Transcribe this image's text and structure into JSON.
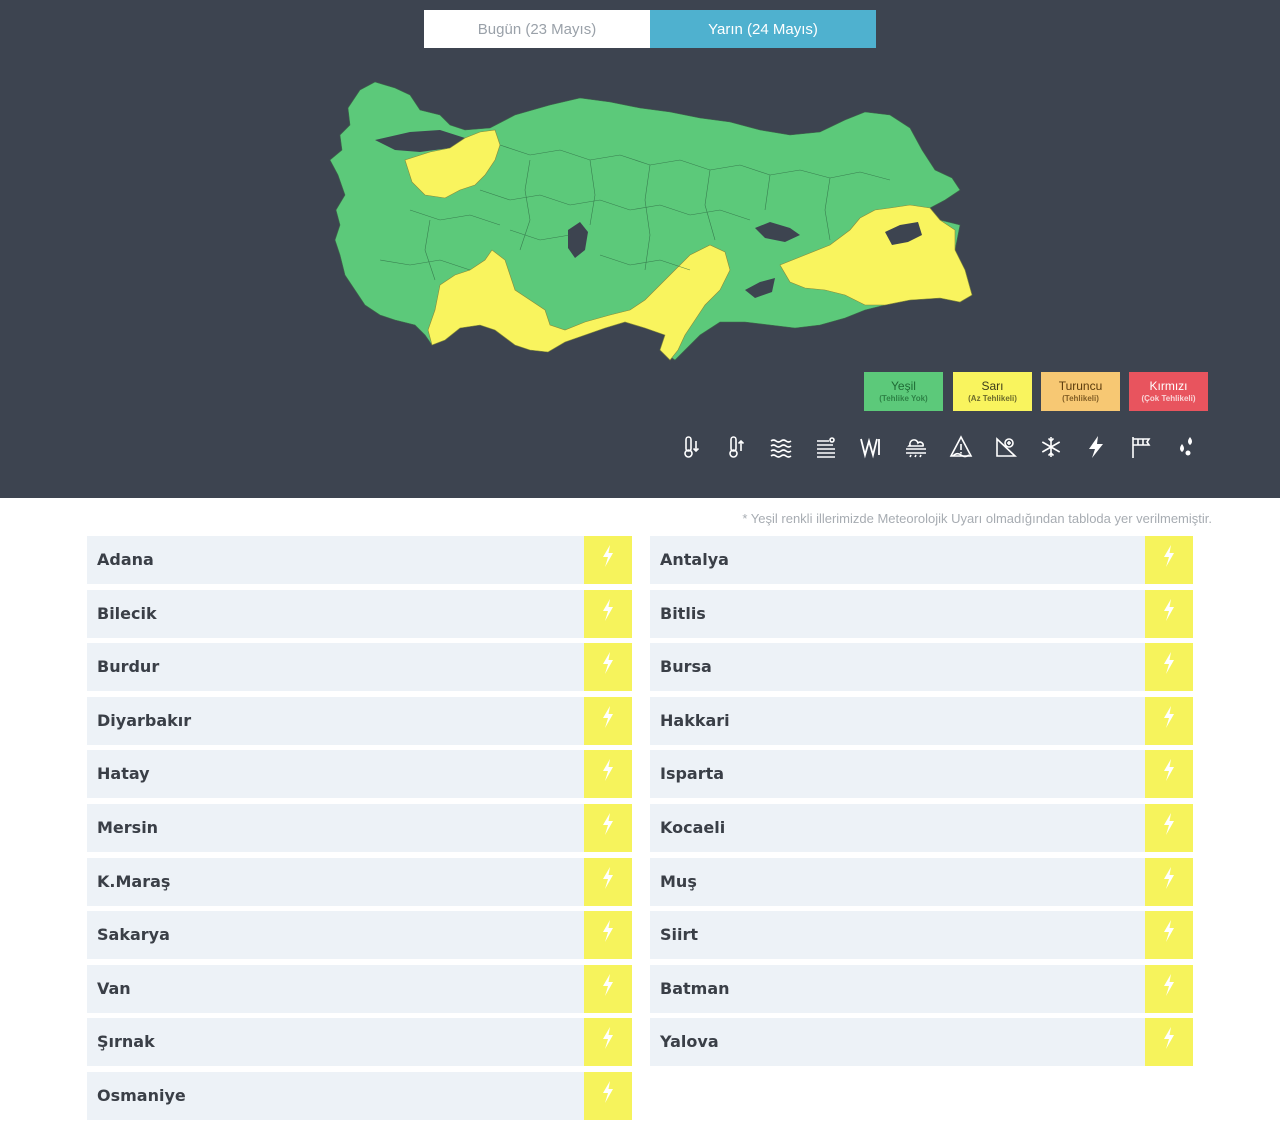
{
  "tabs": [
    {
      "label": "Bugün (23 Mayıs)",
      "active": false
    },
    {
      "label": "Yarın (24 Mayıs)",
      "active": true
    }
  ],
  "colors": {
    "background": "#3d4450",
    "green": "#5cc97a",
    "yellow": "#f9f45e",
    "orange": "#f7c873",
    "red": "#e8545e",
    "accent": "#4fb1cf"
  },
  "legend": [
    {
      "title": "Yeşil",
      "sub": "(Tehlike Yok)"
    },
    {
      "title": "Sarı",
      "sub": "(Az Tehlikeli)"
    },
    {
      "title": "Turuncu",
      "sub": "(Tehlikeli)"
    },
    {
      "title": "Kırmızı",
      "sub": "(Çok Tehlikeli)"
    }
  ],
  "icons": [
    "cold-icon",
    "hot-icon",
    "fog-icon",
    "dust-icon",
    "wind-icon",
    "rain-icon",
    "avalanche-icon",
    "snowmelt-icon",
    "snow-icon",
    "thunderstorm-icon",
    "strong-wind-icon",
    "hail-icon"
  ],
  "note": "* Yeşil renkli illerimizde Meteorolojik Uyarı olmadığından tabloda yer verilmemiştir.",
  "left_provinces": [
    "Adana",
    "Bilecik",
    "Burdur",
    "Diyarbakır",
    "Hatay",
    "Mersin",
    "K.Maraş",
    "Sakarya",
    "Van",
    "Şırnak",
    "Osmaniye"
  ],
  "right_provinces": [
    "Antalya",
    "Bitlis",
    "Bursa",
    "Hakkari",
    "Isparta",
    "Kocaeli",
    "Muş",
    "Siirt",
    "Batman",
    "Yalova"
  ],
  "warning_type": "thunderstorm-icon",
  "warning_level": "yellow"
}
